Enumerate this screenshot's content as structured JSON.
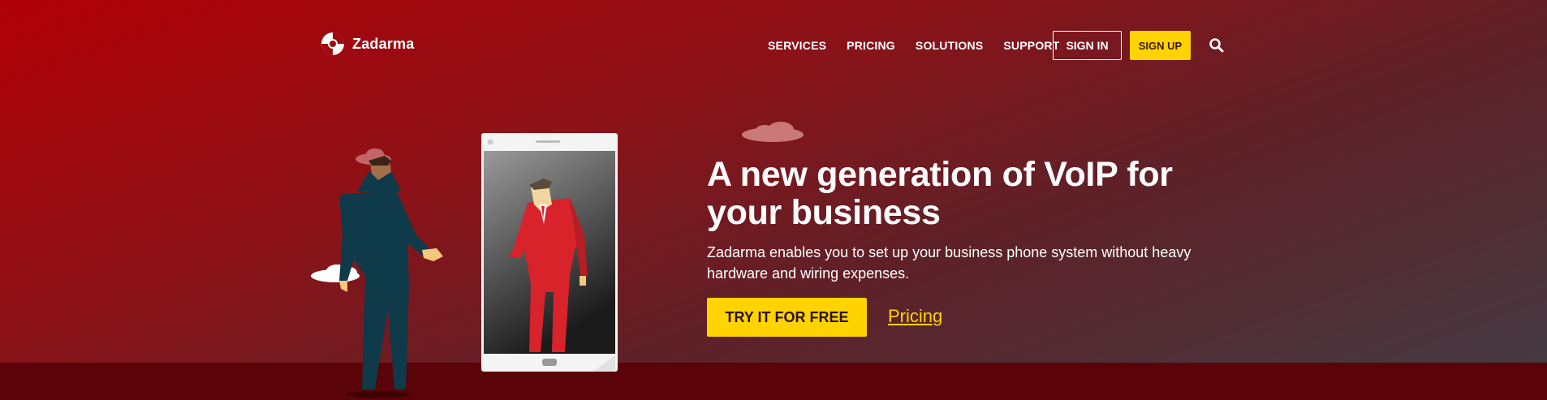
{
  "brand": {
    "name": "Zadarma"
  },
  "nav": {
    "items": [
      {
        "label": "SERVICES"
      },
      {
        "label": "PRICING"
      },
      {
        "label": "SOLUTIONS"
      },
      {
        "label": "SUPPORT"
      }
    ],
    "sign_in": "SIGN IN",
    "sign_up": "SIGN UP",
    "search_icon": "search-icon"
  },
  "hero": {
    "title": "A new generation of VoIP for your business",
    "subtitle": "Zadarma enables you to set up your business phone system without heavy hardware and wiring expenses.",
    "cta": "TRY IT FOR FREE",
    "secondary_link": "Pricing"
  },
  "colors": {
    "accent": "#ffd300",
    "bg_top": "#b00006",
    "bg_bottom": "#423c44",
    "floor": "#5a0308",
    "suit_dark": "#0e3a4a",
    "suit_red": "#d8232b"
  }
}
